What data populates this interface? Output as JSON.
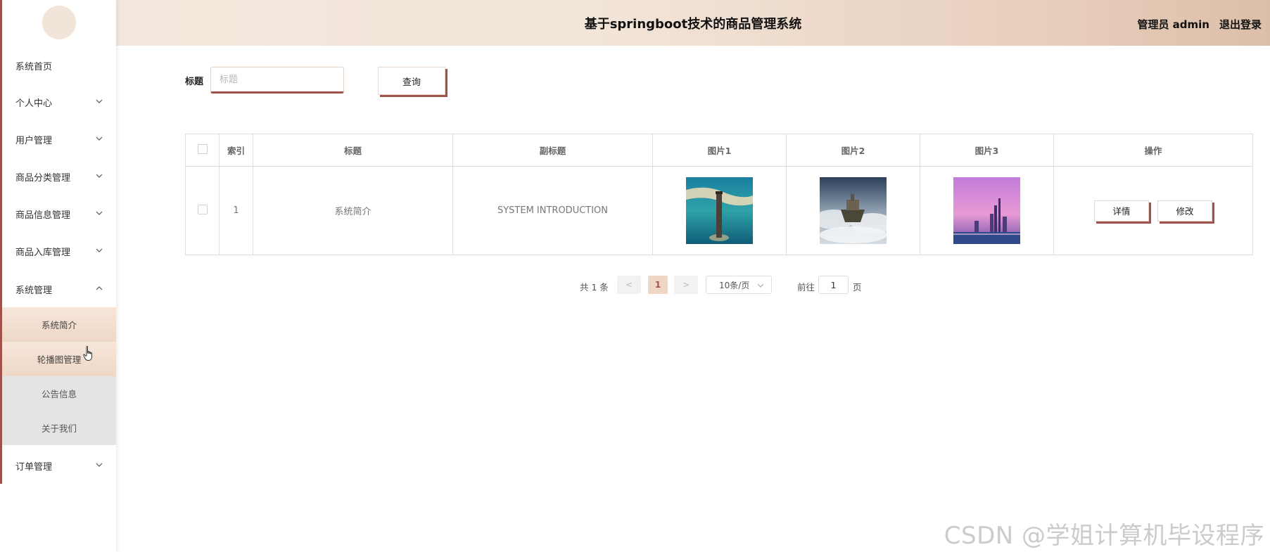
{
  "header": {
    "title": "基于springboot技术的商品管理系统",
    "user": "管理员 admin",
    "logout": "退出登录"
  },
  "sidebar": {
    "items": [
      {
        "label": "系统首页",
        "has_chevron": false
      },
      {
        "label": "个人中心",
        "has_chevron": true,
        "chevron": "down"
      },
      {
        "label": "用户管理",
        "has_chevron": true,
        "chevron": "down"
      },
      {
        "label": "商品分类管理",
        "has_chevron": true,
        "chevron": "down"
      },
      {
        "label": "商品信息管理",
        "has_chevron": true,
        "chevron": "down"
      },
      {
        "label": "商品入库管理",
        "has_chevron": true,
        "chevron": "down"
      },
      {
        "label": "系统管理",
        "has_chevron": true,
        "chevron": "up"
      },
      {
        "label": "订单管理",
        "has_chevron": true,
        "chevron": "down"
      }
    ],
    "submenu": [
      "系统简介",
      "轮播图管理",
      "公告信息",
      "关于我们"
    ]
  },
  "search": {
    "label": "标题",
    "placeholder": "标题",
    "value": "",
    "button": "查询"
  },
  "table": {
    "columns": [
      "",
      "索引",
      "标题",
      "副标题",
      "图片1",
      "图片2",
      "图片3",
      "操作"
    ],
    "rows": [
      {
        "index": "1",
        "title": "系统简介",
        "subtitle": "SYSTEM INTRODUCTION",
        "images": [
          "lighthouse-sea-photo",
          "floating-island-clouds-photo",
          "purple-sky-city-skyline-photo"
        ],
        "actions": [
          "详情",
          "修改"
        ]
      }
    ]
  },
  "pagination": {
    "total": "共 1 条",
    "prev": "<",
    "current": "1",
    "next": ">",
    "page_size": "10条/页",
    "goto_label": "前往",
    "goto_value": "1",
    "page_label": "页"
  },
  "watermark": "CSDN @学姐计算机毕设程序",
  "colors": {
    "accent": "#a0524c",
    "header_gradient_start": "#f4e7dd",
    "header_gradient_end": "#dcbfa9",
    "submenu_highlight": "#efd7c6",
    "current_page": "#f0d6c4"
  }
}
